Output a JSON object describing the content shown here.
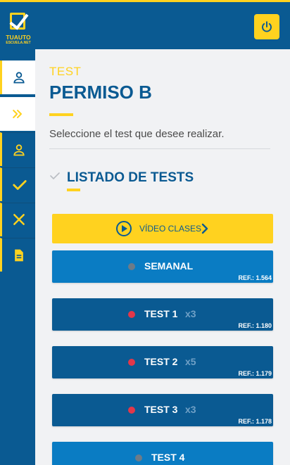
{
  "brand": {
    "name": "TUAUTO",
    "domain": "ESCUELA.NET",
    "colors": {
      "primary": "#0a5a92",
      "accent": "#ffd21f",
      "light_blue": "#0a7cc3",
      "danger": "#e2374a"
    }
  },
  "header": {
    "power_icon": "power-icon"
  },
  "sidebar": {
    "items": [
      {
        "icon": "user-icon",
        "state": "active"
      },
      {
        "icon": "double-chevron-right-icon",
        "state": "toggle"
      },
      {
        "icon": "user-icon",
        "state": "normal"
      },
      {
        "icon": "check-icon",
        "state": "normal"
      },
      {
        "icon": "close-icon",
        "state": "normal"
      },
      {
        "icon": "document-icon",
        "state": "normal"
      }
    ]
  },
  "page": {
    "subtitle": "TEST",
    "title": "PERMISO B",
    "instruction": "Seleccione el test que desee realizar."
  },
  "list": {
    "title": "LISTADO DE TESTS",
    "video_button": "VÍDEO CLASES",
    "tests": [
      {
        "label": "SEMANAL",
        "count": "",
        "ref": "REF.: 1.564",
        "status": "grey",
        "style": "light"
      },
      {
        "label": "TEST 1",
        "count": "x3",
        "ref": "REF.: 1.180",
        "status": "red",
        "style": "dark"
      },
      {
        "label": "TEST 2",
        "count": "x5",
        "ref": "REF.: 1.179",
        "status": "red",
        "style": "dark"
      },
      {
        "label": "TEST 3",
        "count": "x3",
        "ref": "REF.: 1.178",
        "status": "red",
        "style": "dark"
      },
      {
        "label": "TEST 4",
        "count": "",
        "ref": "",
        "status": "grey",
        "style": "light"
      }
    ]
  }
}
